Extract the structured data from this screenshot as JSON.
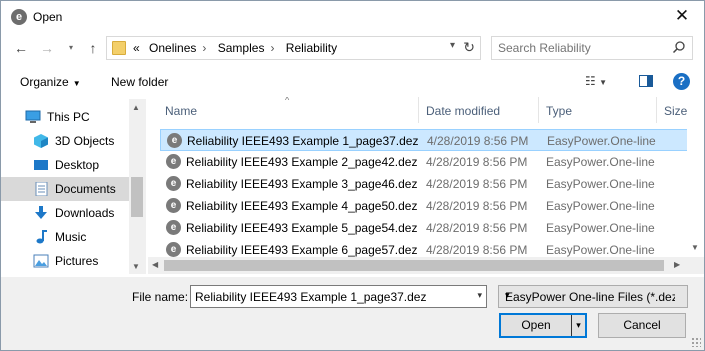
{
  "window": {
    "title": "Open",
    "icon": "easypower-icon"
  },
  "nav": {
    "breadcrumbs": [
      "Onelines",
      "Samples",
      "Reliability"
    ],
    "overflow": "«",
    "search_placeholder": "Search Reliability"
  },
  "toolbar": {
    "organize": "Organize",
    "new_folder": "New folder",
    "help": "?"
  },
  "sidebar": {
    "items": [
      {
        "label": "This PC",
        "icon": "computer-icon"
      },
      {
        "label": "3D Objects",
        "icon": "cube-icon"
      },
      {
        "label": "Desktop",
        "icon": "desktop-icon"
      },
      {
        "label": "Documents",
        "icon": "document-icon"
      },
      {
        "label": "Downloads",
        "icon": "download-icon"
      },
      {
        "label": "Music",
        "icon": "music-icon"
      },
      {
        "label": "Pictures",
        "icon": "pictures-icon"
      }
    ],
    "selected": "Documents"
  },
  "columns": [
    "Name",
    "Date modified",
    "Type",
    "Size"
  ],
  "files": [
    {
      "name": "Reliability IEEE493 Example 1_page37.dez",
      "date": "4/28/2019 8:56 PM",
      "type": "EasyPower.One-line",
      "selected": true
    },
    {
      "name": "Reliability IEEE493 Example 2_page42.dez",
      "date": "4/28/2019 8:56 PM",
      "type": "EasyPower.One-line",
      "selected": false
    },
    {
      "name": "Reliability IEEE493 Example 3_page46.dez",
      "date": "4/28/2019 8:56 PM",
      "type": "EasyPower.One-line",
      "selected": false
    },
    {
      "name": "Reliability IEEE493 Example 4_page50.dez",
      "date": "4/28/2019 8:56 PM",
      "type": "EasyPower.One-line",
      "selected": false
    },
    {
      "name": "Reliability IEEE493 Example 5_page54.dez",
      "date": "4/28/2019 8:56 PM",
      "type": "EasyPower.One-line",
      "selected": false
    },
    {
      "name": "Reliability IEEE493 Example 6_page57.dez",
      "date": "4/28/2019 8:56 PM",
      "type": "EasyPower.One-line",
      "selected": false
    }
  ],
  "footer": {
    "file_name_label": "File name:",
    "file_name_value": "Reliability IEEE493 Example 1_page37.dez",
    "filter_value": "EasyPower One-line Files (*.dez",
    "open_label": "Open",
    "cancel_label": "Cancel"
  },
  "colors": {
    "selection": "#cce8ff",
    "accent": "#0078d7",
    "sidebar_active": "#d9d9d9"
  }
}
